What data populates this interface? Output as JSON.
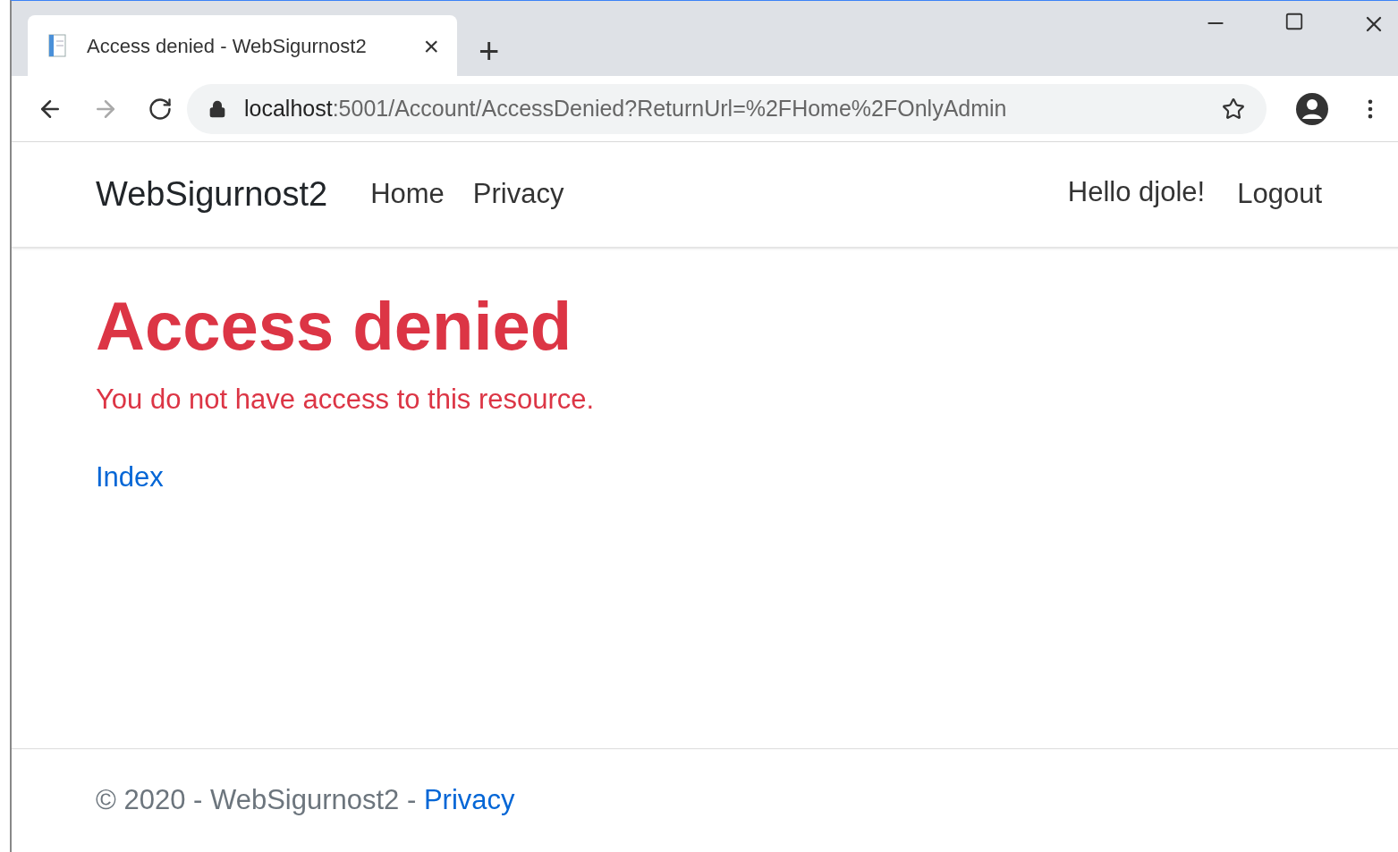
{
  "browser": {
    "tab": {
      "title": "Access denied - WebSigurnost2",
      "close": "×"
    },
    "new_tab": "+",
    "url": {
      "host": "localhost",
      "path": ":5001/Account/AccessDenied?ReturnUrl=%2FHome%2FOnlyAdmin"
    }
  },
  "navbar": {
    "brand": "WebSigurnost2",
    "links": [
      {
        "label": "Home"
      },
      {
        "label": "Privacy"
      }
    ],
    "greeting": "Hello djole!",
    "logout": "Logout"
  },
  "main": {
    "heading": "Access denied",
    "message": "You do not have access to this resource.",
    "link": "Index"
  },
  "footer": {
    "text": "© 2020 - WebSigurnost2 - ",
    "link": "Privacy"
  }
}
